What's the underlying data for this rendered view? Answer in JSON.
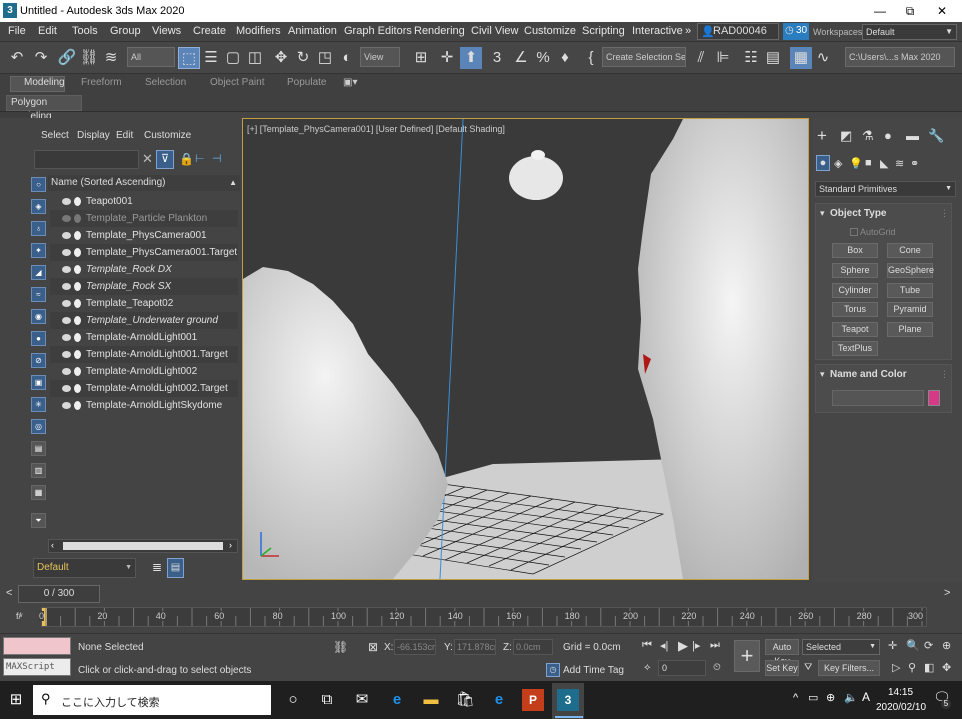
{
  "title": "Untitled - Autodesk 3ds Max 2020",
  "window_controls": {
    "minimize": "—",
    "maximize": "⧉",
    "close": "✕"
  },
  "menu": [
    "File",
    "Edit",
    "Tools",
    "Group",
    "Views",
    "Create",
    "Modifiers",
    "Animation",
    "Graph Editors",
    "Rendering",
    "Civil View",
    "Customize",
    "Scripting",
    "Interactive"
  ],
  "menu_more": "»",
  "user": {
    "name": "RAD00046",
    "badge": "30"
  },
  "workspace": {
    "label": "Workspaces:",
    "value": "Default"
  },
  "toolbar": {
    "selection_filter": "All",
    "view_dropdown": "View",
    "create_selection_set": "Create Selection Se",
    "path": "C:\\Users\\...s Max 2020"
  },
  "ribbon": {
    "tabs": [
      "Modeling",
      "Freeform",
      "Selection",
      "Object Paint",
      "Populate"
    ],
    "subtab": "Polygon Modeling"
  },
  "scene_explorer": {
    "menu": [
      "Select",
      "Display",
      "Edit",
      "Customize"
    ],
    "header": "Name (Sorted Ascending)",
    "items": [
      {
        "name": "Teapot001",
        "style": "normal"
      },
      {
        "name": "Template_Particle Plankton",
        "style": "dim"
      },
      {
        "name": "Template_PhysCamera001",
        "style": "normal"
      },
      {
        "name": "Template_PhysCamera001.Target",
        "style": "normal"
      },
      {
        "name": "Template_Rock DX",
        "style": "italic"
      },
      {
        "name": "Template_Rock SX",
        "style": "italic"
      },
      {
        "name": "Template_Teapot02",
        "style": "normal"
      },
      {
        "name": "Template_Underwater ground",
        "style": "italic"
      },
      {
        "name": "Template-ArnoldLight001",
        "style": "normal"
      },
      {
        "name": "Template-ArnoldLight001.Target",
        "style": "normal"
      },
      {
        "name": "Template-ArnoldLight002",
        "style": "normal"
      },
      {
        "name": "Template-ArnoldLight002.Target",
        "style": "normal"
      },
      {
        "name": "Template-ArnoldLightSkydome",
        "style": "normal"
      }
    ],
    "layer": "Default"
  },
  "viewport": {
    "label": "[+] [Template_PhysCamera001] [User Defined] [Default Shading]"
  },
  "command_panel": {
    "category": "Standard Primitives",
    "object_type_title": "Object Type",
    "autogrid": "AutoGrid",
    "primitives": [
      "Box",
      "Cone",
      "Sphere",
      "GeoSphere",
      "Cylinder",
      "Tube",
      "Torus",
      "Pyramid",
      "Teapot",
      "Plane",
      "TextPlus"
    ],
    "name_color_title": "Name and Color",
    "color": "#d63a86"
  },
  "timeline": {
    "frame": "0 / 300",
    "ticks": [
      "0",
      "20",
      "40",
      "60",
      "80",
      "100",
      "120",
      "140",
      "160",
      "180",
      "200",
      "220",
      "240",
      "260",
      "280",
      "300"
    ]
  },
  "status": {
    "selection": "None Selected",
    "prompt": "Click or click-and-drag to select objects",
    "maxscript": "MAXScript Mi",
    "x": "-66.153cm",
    "y": "171.878cm",
    "z": "0.0cm",
    "grid": "Grid = 0.0cm",
    "add_time_tag": "Add Time Tag",
    "frame_field": "0",
    "auto_key": "Auto Key",
    "set_key": "Set Key",
    "selected": "Selected",
    "key_filters": "Key Filters..."
  },
  "taskbar": {
    "search_placeholder": "ここに入力して検索",
    "time": "14:15",
    "date": "2020/02/10",
    "ime": "A",
    "notif": "5"
  }
}
